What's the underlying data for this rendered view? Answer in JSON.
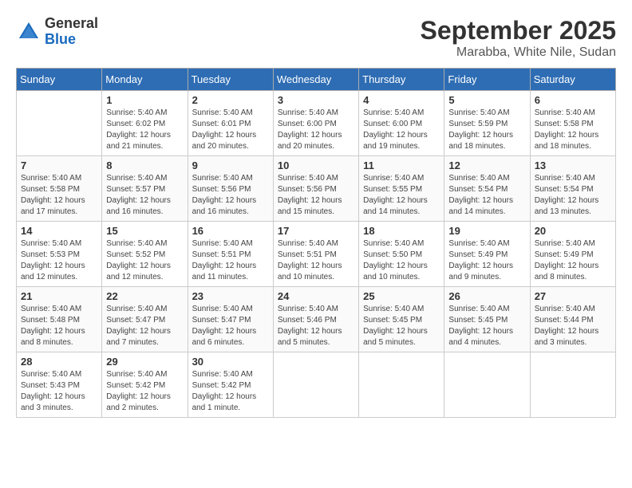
{
  "header": {
    "logo_general": "General",
    "logo_blue": "Blue",
    "month": "September 2025",
    "location": "Marabba, White Nile, Sudan"
  },
  "days_of_week": [
    "Sunday",
    "Monday",
    "Tuesday",
    "Wednesday",
    "Thursday",
    "Friday",
    "Saturday"
  ],
  "weeks": [
    [
      {
        "day": "",
        "info": ""
      },
      {
        "day": "1",
        "info": "Sunrise: 5:40 AM\nSunset: 6:02 PM\nDaylight: 12 hours\nand 21 minutes."
      },
      {
        "day": "2",
        "info": "Sunrise: 5:40 AM\nSunset: 6:01 PM\nDaylight: 12 hours\nand 20 minutes."
      },
      {
        "day": "3",
        "info": "Sunrise: 5:40 AM\nSunset: 6:00 PM\nDaylight: 12 hours\nand 20 minutes."
      },
      {
        "day": "4",
        "info": "Sunrise: 5:40 AM\nSunset: 6:00 PM\nDaylight: 12 hours\nand 19 minutes."
      },
      {
        "day": "5",
        "info": "Sunrise: 5:40 AM\nSunset: 5:59 PM\nDaylight: 12 hours\nand 18 minutes."
      },
      {
        "day": "6",
        "info": "Sunrise: 5:40 AM\nSunset: 5:58 PM\nDaylight: 12 hours\nand 18 minutes."
      }
    ],
    [
      {
        "day": "7",
        "info": "Sunrise: 5:40 AM\nSunset: 5:58 PM\nDaylight: 12 hours\nand 17 minutes."
      },
      {
        "day": "8",
        "info": "Sunrise: 5:40 AM\nSunset: 5:57 PM\nDaylight: 12 hours\nand 16 minutes."
      },
      {
        "day": "9",
        "info": "Sunrise: 5:40 AM\nSunset: 5:56 PM\nDaylight: 12 hours\nand 16 minutes."
      },
      {
        "day": "10",
        "info": "Sunrise: 5:40 AM\nSunset: 5:56 PM\nDaylight: 12 hours\nand 15 minutes."
      },
      {
        "day": "11",
        "info": "Sunrise: 5:40 AM\nSunset: 5:55 PM\nDaylight: 12 hours\nand 14 minutes."
      },
      {
        "day": "12",
        "info": "Sunrise: 5:40 AM\nSunset: 5:54 PM\nDaylight: 12 hours\nand 14 minutes."
      },
      {
        "day": "13",
        "info": "Sunrise: 5:40 AM\nSunset: 5:54 PM\nDaylight: 12 hours\nand 13 minutes."
      }
    ],
    [
      {
        "day": "14",
        "info": "Sunrise: 5:40 AM\nSunset: 5:53 PM\nDaylight: 12 hours\nand 12 minutes."
      },
      {
        "day": "15",
        "info": "Sunrise: 5:40 AM\nSunset: 5:52 PM\nDaylight: 12 hours\nand 12 minutes."
      },
      {
        "day": "16",
        "info": "Sunrise: 5:40 AM\nSunset: 5:51 PM\nDaylight: 12 hours\nand 11 minutes."
      },
      {
        "day": "17",
        "info": "Sunrise: 5:40 AM\nSunset: 5:51 PM\nDaylight: 12 hours\nand 10 minutes."
      },
      {
        "day": "18",
        "info": "Sunrise: 5:40 AM\nSunset: 5:50 PM\nDaylight: 12 hours\nand 10 minutes."
      },
      {
        "day": "19",
        "info": "Sunrise: 5:40 AM\nSunset: 5:49 PM\nDaylight: 12 hours\nand 9 minutes."
      },
      {
        "day": "20",
        "info": "Sunrise: 5:40 AM\nSunset: 5:49 PM\nDaylight: 12 hours\nand 8 minutes."
      }
    ],
    [
      {
        "day": "21",
        "info": "Sunrise: 5:40 AM\nSunset: 5:48 PM\nDaylight: 12 hours\nand 8 minutes."
      },
      {
        "day": "22",
        "info": "Sunrise: 5:40 AM\nSunset: 5:47 PM\nDaylight: 12 hours\nand 7 minutes."
      },
      {
        "day": "23",
        "info": "Sunrise: 5:40 AM\nSunset: 5:47 PM\nDaylight: 12 hours\nand 6 minutes."
      },
      {
        "day": "24",
        "info": "Sunrise: 5:40 AM\nSunset: 5:46 PM\nDaylight: 12 hours\nand 5 minutes."
      },
      {
        "day": "25",
        "info": "Sunrise: 5:40 AM\nSunset: 5:45 PM\nDaylight: 12 hours\nand 5 minutes."
      },
      {
        "day": "26",
        "info": "Sunrise: 5:40 AM\nSunset: 5:45 PM\nDaylight: 12 hours\nand 4 minutes."
      },
      {
        "day": "27",
        "info": "Sunrise: 5:40 AM\nSunset: 5:44 PM\nDaylight: 12 hours\nand 3 minutes."
      }
    ],
    [
      {
        "day": "28",
        "info": "Sunrise: 5:40 AM\nSunset: 5:43 PM\nDaylight: 12 hours\nand 3 minutes."
      },
      {
        "day": "29",
        "info": "Sunrise: 5:40 AM\nSunset: 5:42 PM\nDaylight: 12 hours\nand 2 minutes."
      },
      {
        "day": "30",
        "info": "Sunrise: 5:40 AM\nSunset: 5:42 PM\nDaylight: 12 hours\nand 1 minute."
      },
      {
        "day": "",
        "info": ""
      },
      {
        "day": "",
        "info": ""
      },
      {
        "day": "",
        "info": ""
      },
      {
        "day": "",
        "info": ""
      }
    ]
  ]
}
